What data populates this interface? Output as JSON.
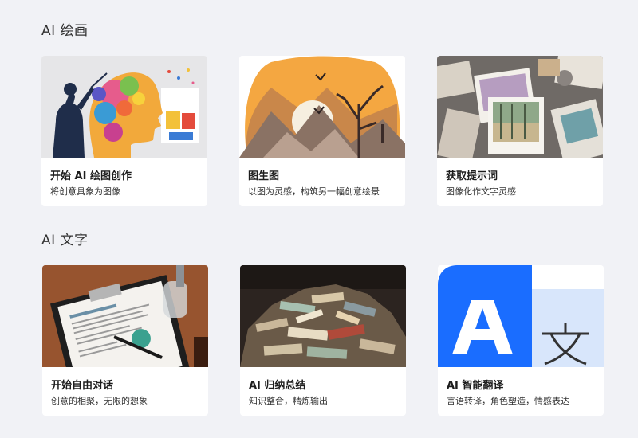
{
  "sections": {
    "drawing": {
      "title": "AI 绘画",
      "cards": [
        {
          "title": "开始 AI 绘图创作",
          "desc": "将创意具象为图像",
          "thumb_icon": "colorful-head-painting-illustration"
        },
        {
          "title": "图生图",
          "desc": "以图为灵感，构筑另一幅创意绘景",
          "thumb_icon": "sunset-mountain-bird-illustration"
        },
        {
          "title": "获取提示词",
          "desc": "图像化作文字灵感",
          "thumb_icon": "scattered-photos-illustration"
        }
      ]
    },
    "text": {
      "title": "AI 文字",
      "cards": [
        {
          "title": "开始自由对话",
          "desc": "创意的相聚，无限的想象",
          "thumb_icon": "clipboard-document-pen-illustration"
        },
        {
          "title": "AI 归纳总结",
          "desc": "知识整合，精炼输出",
          "thumb_icon": "book-pile-illustration"
        },
        {
          "title": "AI 智能翻译",
          "desc": "言语转译，角色塑造，情感表达",
          "thumb_icon": "translate-icon"
        }
      ]
    }
  },
  "colors": {
    "background": "#f1f2f6",
    "card": "#ffffff",
    "translate_blue": "#1a6dff",
    "translate_light": "#d8e6fb"
  }
}
